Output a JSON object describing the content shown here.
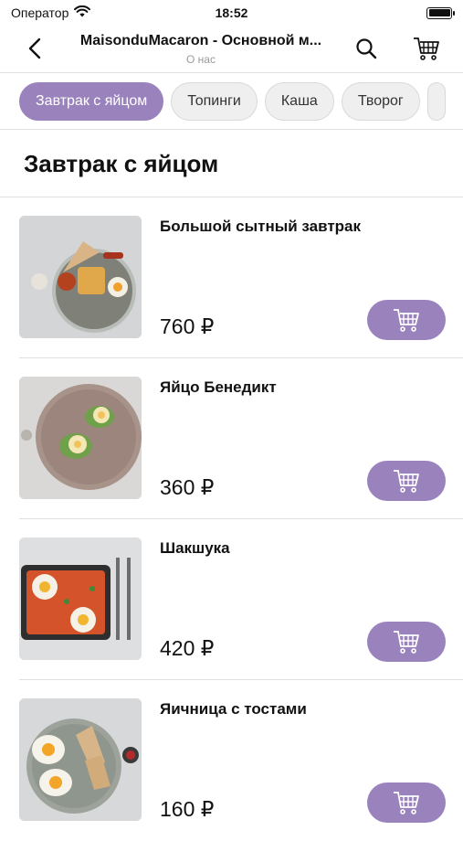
{
  "status": {
    "carrier": "Оператор",
    "time": "18:52"
  },
  "nav": {
    "title": "MaisonduMacaron - Основной м...",
    "subtitle": "О нас"
  },
  "categories": [
    {
      "label": "Завтрак с яйцом",
      "active": true
    },
    {
      "label": "Топинги"
    },
    {
      "label": "Каша"
    },
    {
      "label": "Творог"
    }
  ],
  "section": {
    "title": "Завтрак с яйцом"
  },
  "items": [
    {
      "name": "Большой сытный завтрак",
      "price": "760 ₽"
    },
    {
      "name": "Яйцо Бенедикт",
      "price": "360 ₽"
    },
    {
      "name": "Шакшука",
      "price": "420 ₽"
    },
    {
      "name": "Яичница с тостами",
      "price": "160 ₽"
    }
  ],
  "colors": {
    "accent": "#9a83bd",
    "chip_bg": "#efefef",
    "divider": "#e0e0e0"
  }
}
